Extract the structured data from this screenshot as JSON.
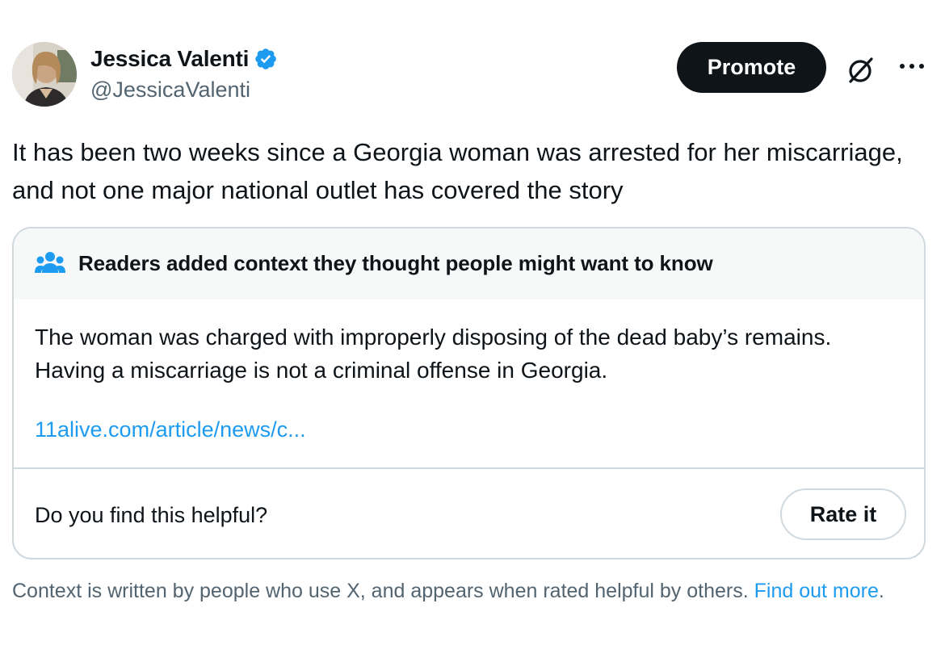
{
  "tweet": {
    "author_name": "Jessica Valenti",
    "author_handle": "@JessicaValenti",
    "verified": true,
    "text": "It has been two weeks since a Georgia woman was arrested for her miscarriage, and not one major national outlet has covered the story"
  },
  "actions": {
    "promote_label": "Promote",
    "grok_icon": "grok-icon",
    "more_icon": "more-icon"
  },
  "community_note": {
    "header_icon": "people-icon",
    "header_title": "Readers added context they thought people might want to know",
    "body": "The woman was charged with improperly disposing of the dead baby’s remains.   Having a miscarriage is not a criminal offense in Georgia.",
    "link_text": "11alive.com/article/news/c...",
    "helpful_question": "Do you find this helpful?",
    "rate_label": "Rate it"
  },
  "footer": {
    "text": "Context is written by people who use X, and appears when rated helpful by others.",
    "link_text": "Find out more",
    "period": "."
  },
  "colors": {
    "accent": "#1d9bf0",
    "text_primary": "#0f1419",
    "text_secondary": "#536471",
    "border": "#cfd9de",
    "header_bg": "#f7f9f9"
  }
}
